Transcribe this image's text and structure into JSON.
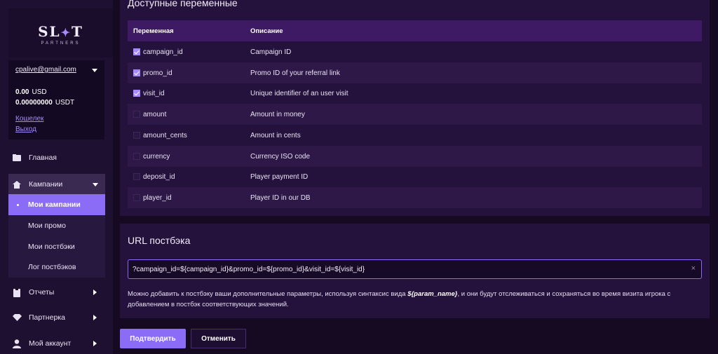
{
  "brand": {
    "logo_main_left": "SL",
    "logo_symbol": "✦",
    "logo_main_right": "T",
    "logo_sub": "PARTNERS"
  },
  "account": {
    "email": "cpalive@gmail.com",
    "balance_usd_amount": "0.00",
    "balance_usd_currency": "USD",
    "balance_usdt_amount": "0.00000000",
    "balance_usdt_currency": "USDT",
    "wallet_link": "Кошелек",
    "logout_link": "Выход"
  },
  "nav": {
    "home": "Главная",
    "campaigns": "Кампании",
    "campaigns_sub": [
      "Мои кампании",
      "Мои промо",
      "Мои постбэки",
      "Лог постбэков"
    ],
    "reports": "Отчеты",
    "partner": "Партнерка",
    "my_account": "Мой аккаунт"
  },
  "variables_panel": {
    "title": "Доступные переменные",
    "col_variable": "Переменная",
    "col_description": "Описание",
    "rows": [
      {
        "name": "campaign_id",
        "description": "Campaign ID",
        "checked": true
      },
      {
        "name": "promo_id",
        "description": "Promo ID of your referral link",
        "checked": true
      },
      {
        "name": "visit_id",
        "description": "Unique identifier of an user visit",
        "checked": true
      },
      {
        "name": "amount",
        "description": "Amount in money",
        "checked": false
      },
      {
        "name": "amount_cents",
        "description": "Amount in cents",
        "checked": false
      },
      {
        "name": "currency",
        "description": "Currency ISO code",
        "checked": false
      },
      {
        "name": "deposit_id",
        "description": "Player payment ID",
        "checked": false
      },
      {
        "name": "player_id",
        "description": "Player ID in our DB",
        "checked": false
      }
    ]
  },
  "url_panel": {
    "title": "URL постбэка",
    "value": "?campaign_id=${campaign_id}&promo_id=${promo_id}&visit_id=${visit_id}",
    "clear_icon": "×",
    "hint_before": "Можно добавить к постбэку ваши дополнительные параметры, используя синтаксис вида ",
    "hint_param": "${param_name}",
    "hint_after": ", и они будут отслеживаться и сохраняться во время визита игрока с добавлением в постбэк соответствующих значений."
  },
  "actions": {
    "confirm": "Подтвердить",
    "cancel": "Отменить"
  },
  "colors": {
    "accent": "#8b6cf6",
    "sidebar": "#1d1030",
    "panel": "#24123c",
    "table_header": "#3e1a64"
  }
}
